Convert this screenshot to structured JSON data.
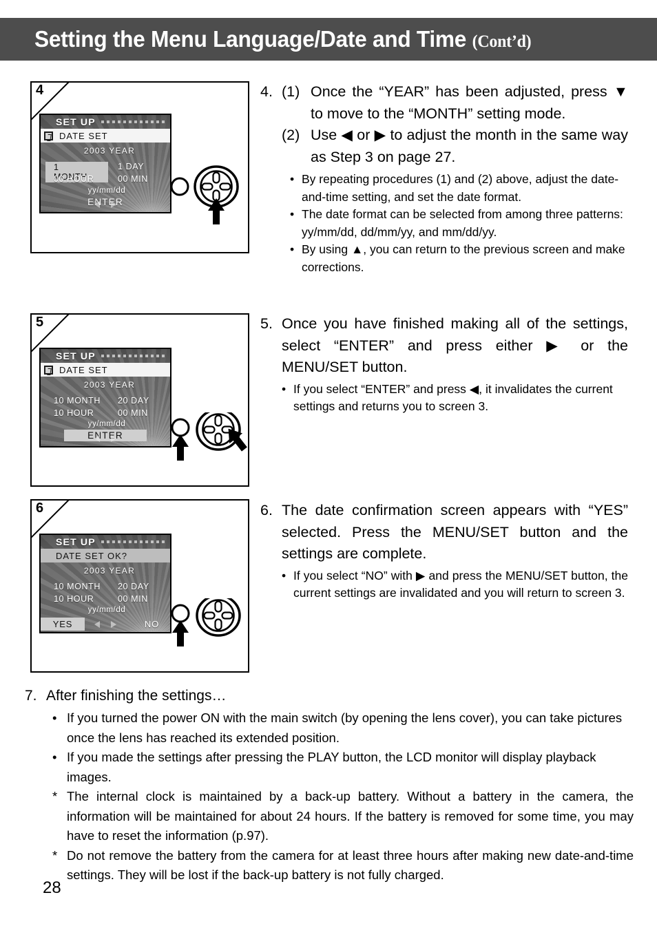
{
  "header": {
    "title": "Setting the Menu Language/Date and Time ",
    "cont": "(Cont’d)"
  },
  "page_number": "28",
  "steps": [
    {
      "figure_number": "4",
      "lcd": {
        "setup_label": "SET UP",
        "title": "DATE SET",
        "has_tool_icon": true,
        "title_bar_style": "white",
        "year": "2003  YEAR",
        "month": "1 MONTH",
        "day": "1 DAY",
        "hour": "00 HOUR",
        "minute": "00 MIN",
        "format": "yy/mm/dd",
        "enter": "ENTER",
        "highlight": "month",
        "left_arrow": "◀",
        "right_arrow": "▶"
      },
      "controller": {
        "menu_set_button": "MENU/SET",
        "arrow_target": "down"
      },
      "number": "4.",
      "sub_items": [
        {
          "label": "(1)",
          "text": "Once the “YEAR” has been adjusted, press ▼ to move to the “MONTH” setting mode."
        },
        {
          "label": "(2)",
          "text": "Use ◀ or ▶ to adjust the month in the same way as Step 3 on page 27."
        }
      ],
      "bullets": [
        "By repeating procedures (1) and (2) above, adjust the date-and-time setting, and set the date format.",
        "The date format can be selected from among three patterns: yy/mm/dd, dd/mm/yy, and mm/dd/yy.",
        "By using ▲, you can return to the previous screen and make corrections."
      ]
    },
    {
      "figure_number": "5",
      "lcd": {
        "setup_label": "SET UP",
        "title": "DATE SET",
        "has_tool_icon": true,
        "title_bar_style": "white",
        "year": "2003  YEAR",
        "month": "10 MONTH",
        "day": "20 DAY",
        "hour": "10 HOUR",
        "minute": "00 MIN",
        "format": "yy/mm/dd",
        "enter": "ENTER",
        "highlight": "enter",
        "left_arrow": "◀",
        "right_arrow": "▶"
      },
      "controller": {
        "menu_set_button": "MENU/SET",
        "arrow_target": "right-and-menu"
      },
      "number": "5.",
      "text": "Once you have finished making all of the settings, select “ENTER” and press either ▶ or the MENU/SET button.",
      "bullets": [
        "If you select “ENTER” and press ◀, it invalidates the current settings and returns you to screen 3."
      ]
    },
    {
      "figure_number": "6",
      "lcd": {
        "setup_label": "SET UP",
        "title": "DATE SET OK?",
        "has_tool_icon": false,
        "title_bar_style": "gray",
        "year": "2003  YEAR",
        "month": "10 MONTH",
        "day": "20 DAY",
        "hour": "10 HOUR",
        "minute": "00 MIN",
        "format": "yy/mm/dd",
        "yes": "YES",
        "no": "NO",
        "highlight": "yes",
        "left_arrow": "◀",
        "right_arrow": "▶"
      },
      "controller": {
        "menu_set_button": "MENU/SET",
        "arrow_target": "menu"
      },
      "number": "6.",
      "text": "The date confirmation screen appears with “YES” selected. Press the MENU/SET button and the settings are complete.",
      "bullets": [
        "If you select “NO” with ▶ and press the MENU/SET button, the current settings are invalidated and you will return to screen 3."
      ]
    }
  ],
  "final_step": {
    "number": "7.",
    "title": "After finishing the settings…",
    "bullets": [
      {
        "mark": "•",
        "text": "If you turned the power ON with the main switch (by opening the lens cover), you can take pictures once the lens has reached its extended position."
      },
      {
        "mark": "•",
        "text": "If you made the settings after pressing the PLAY button, the LCD monitor will display playback images."
      },
      {
        "mark": "*",
        "text": "The internal clock is maintained by a back-up battery. Without a battery in the camera, the information will be maintained for about 24 hours. If the battery is removed for some time, you may have to reset the information (p.97)."
      },
      {
        "mark": "*",
        "text": "Do not remove the battery from the camera for at least three hours after making new date-and-time settings. They will be lost if the back-up battery is not fully charged."
      }
    ]
  }
}
